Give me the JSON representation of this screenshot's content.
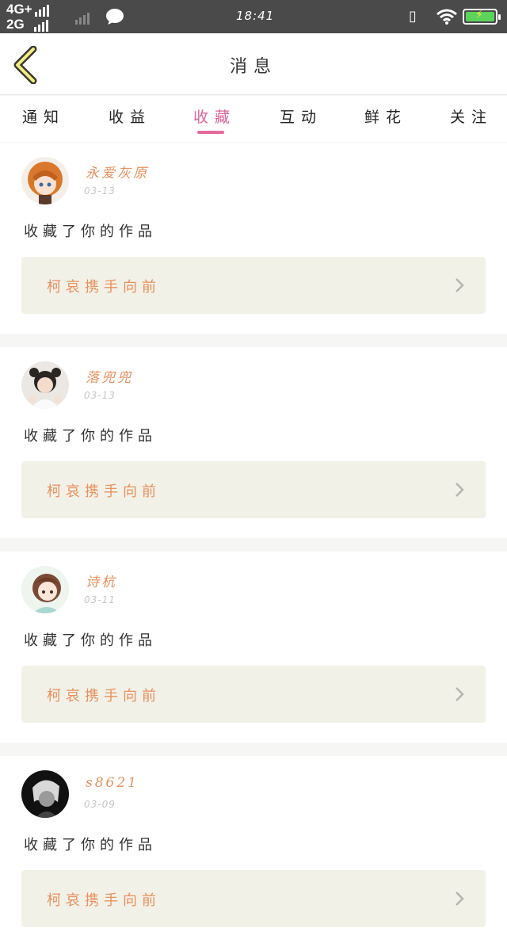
{
  "status": {
    "net1": "4G+",
    "net2": "2G",
    "time": "18:41",
    "battery_color": "#5bd35b"
  },
  "header": {
    "title": "消息",
    "back_icon": "chevron-left-icon"
  },
  "tabs": [
    {
      "label": "通知",
      "active": false
    },
    {
      "label": "收益",
      "active": false
    },
    {
      "label": "收藏",
      "active": true
    },
    {
      "label": "互动",
      "active": false
    },
    {
      "label": "鲜花",
      "active": false
    },
    {
      "label": "关注",
      "active": false
    }
  ],
  "notifications": [
    {
      "username": "永爱灰原",
      "date": "03-13",
      "action": "收藏了你的作品",
      "work_title": "柯哀携手向前"
    },
    {
      "username": "落兜兜",
      "date": "03-13",
      "action": "收藏了你的作品",
      "work_title": "柯哀携手向前"
    },
    {
      "username": "诗杭",
      "date": "03-11",
      "action": "收藏了你的作品",
      "work_title": "柯哀携手向前"
    },
    {
      "username": "s8621",
      "date": "03-09",
      "action": "收藏了你的作品",
      "work_title": "柯哀携手向前"
    }
  ],
  "colors": {
    "accent_pink": "#e8699c",
    "username_orange": "#e8915e",
    "card_bg": "#f2f1e8"
  }
}
